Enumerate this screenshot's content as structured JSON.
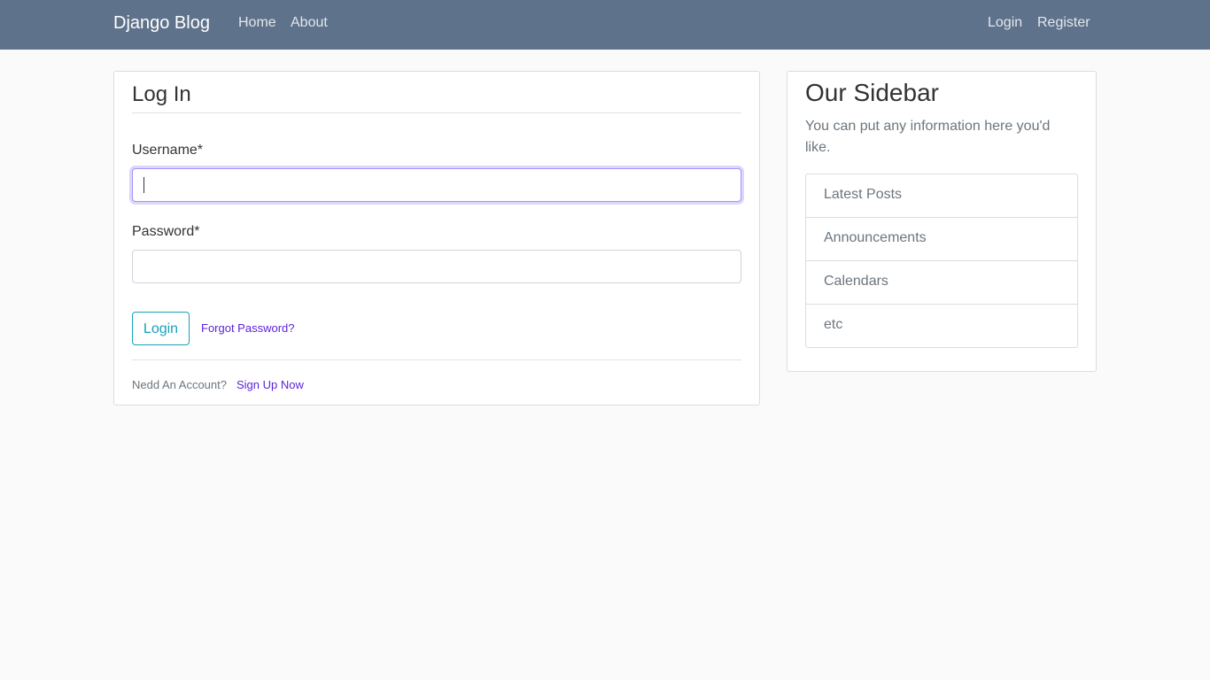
{
  "navbar": {
    "brand": "Django Blog",
    "links": [
      "Home",
      "About"
    ],
    "right_links": [
      "Login",
      "Register"
    ],
    "background": "#5f728b"
  },
  "login": {
    "title": "Log In",
    "username_label": "Username*",
    "username_value": "",
    "password_label": "Password*",
    "password_value": "",
    "submit_label": "Login",
    "forgot_label": "Forgot Password?",
    "account_prompt": "Nedd An Account?",
    "signup_label": "Sign Up Now"
  },
  "sidebar": {
    "title": "Our Sidebar",
    "description": "You can put any information here you'd like.",
    "items": [
      "Latest Posts",
      "Announcements",
      "Calendars",
      "etc"
    ]
  },
  "colors": {
    "accent": "#17a2b8",
    "link": "#5a1fd8",
    "focus": "#a594f9"
  }
}
